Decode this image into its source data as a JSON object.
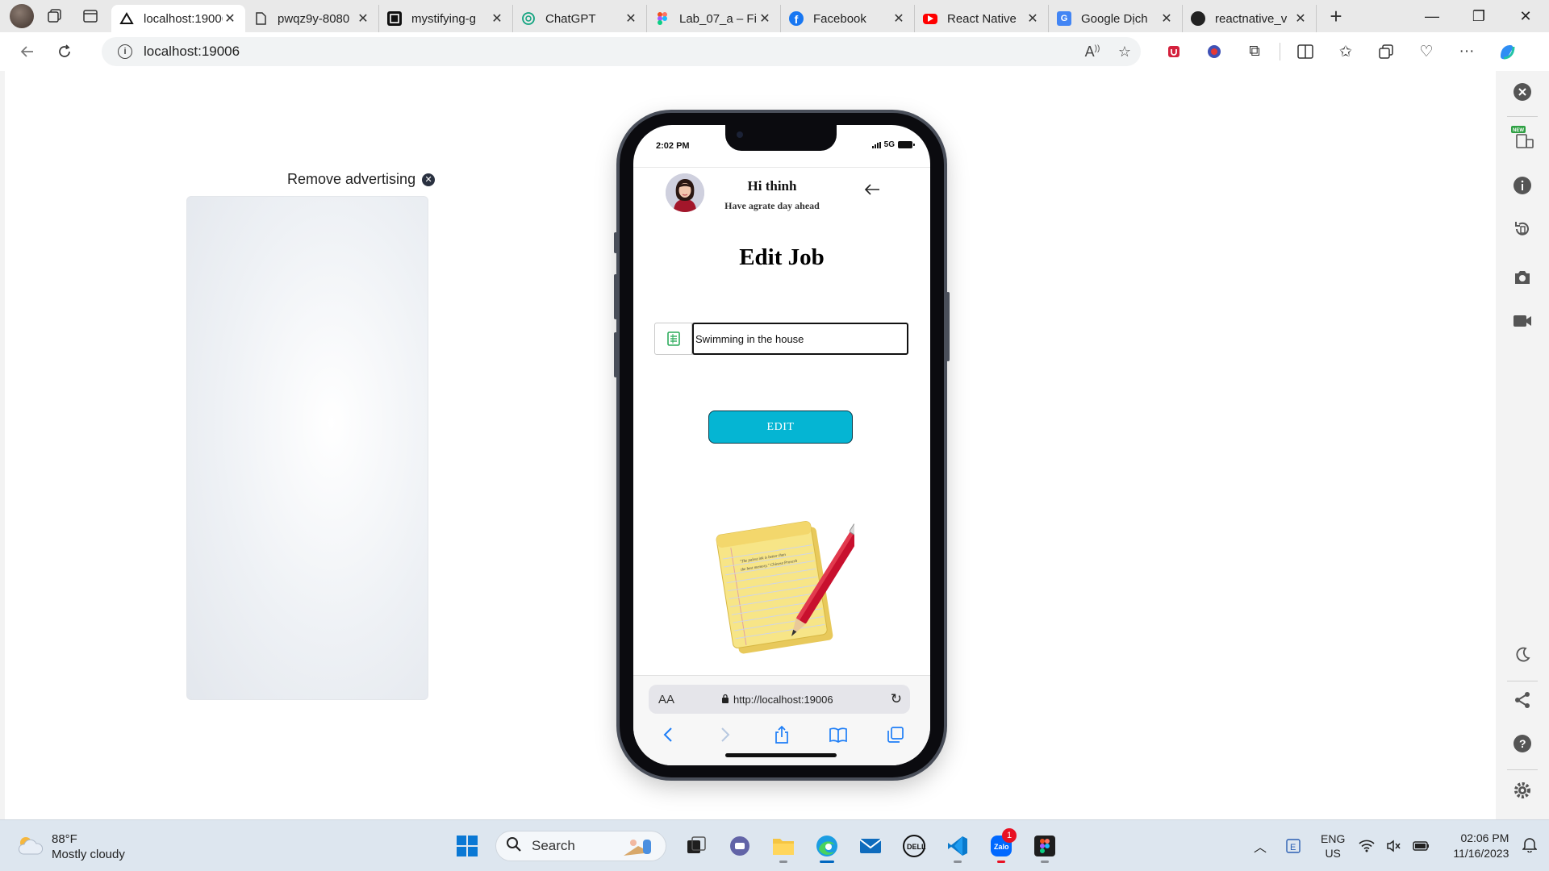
{
  "browser": {
    "tabs": [
      {
        "label": "localhost:19006",
        "active": true,
        "favicon": "expo-icon"
      },
      {
        "label": "pwqz9y-8080",
        "active": false,
        "favicon": "page-icon"
      },
      {
        "label": "mystifying-g",
        "active": false,
        "favicon": "codesandbox-icon"
      },
      {
        "label": "ChatGPT",
        "active": false,
        "favicon": "chatgpt-icon"
      },
      {
        "label": "Lab_07_a – Fi",
        "active": false,
        "favicon": "figma-icon"
      },
      {
        "label": "Facebook",
        "active": false,
        "favicon": "facebook-icon"
      },
      {
        "label": "React Native",
        "active": false,
        "favicon": "youtube-icon"
      },
      {
        "label": "Google Dịch",
        "active": false,
        "favicon": "google-translate-icon"
      },
      {
        "label": "reactnative_v",
        "active": false,
        "favicon": "github-icon"
      }
    ],
    "url": "localhost:19006"
  },
  "ad": {
    "remove_label": "Remove advertising"
  },
  "phone": {
    "status_time": "2:02 PM",
    "network": "5G",
    "user_greeting": "Hi thinh",
    "user_subtitle": "Have agrate day ahead",
    "page_title": "Edit Job",
    "job_input_value": "Swimming in the house",
    "edit_button_label": "EDIT",
    "notepad_quote": "\"The palest ink is better than the best memory.\" — Chinese Proverb",
    "safari": {
      "text_size": "AA",
      "address": "http://localhost:19006"
    }
  },
  "taskbar": {
    "weather_temp": "88°F",
    "weather_desc": "Mostly cloudy",
    "search_label": "Search",
    "zalo_badge": "1",
    "lang_top": "ENG",
    "lang_bottom": "US",
    "time": "02:06 PM",
    "date": "11/16/2023"
  },
  "sidebar": {
    "new_badge": "NEW"
  },
  "colors": {
    "accent": "#05b5d3",
    "edge_blue": "#0067c0"
  }
}
